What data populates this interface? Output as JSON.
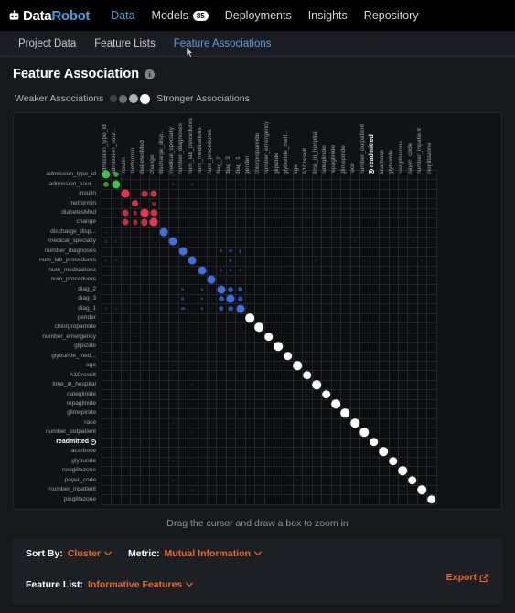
{
  "topnav": {
    "brand_data": "Data",
    "brand_robot": "Robot",
    "brand_icon": "robot-icon",
    "items": [
      {
        "label": "Data",
        "active": true,
        "badge": null
      },
      {
        "label": "Models",
        "active": false,
        "badge": "85"
      },
      {
        "label": "Deployments",
        "active": false,
        "badge": null
      },
      {
        "label": "Insights",
        "active": false,
        "badge": null
      },
      {
        "label": "Repository",
        "active": false,
        "badge": null
      }
    ]
  },
  "tabs": [
    {
      "label": "Project Data",
      "active": false
    },
    {
      "label": "Feature Lists",
      "active": false
    },
    {
      "label": "Feature Associations",
      "active": true
    }
  ],
  "header": {
    "title": "Feature Association",
    "info_icon": "info-icon",
    "info_glyph": "i"
  },
  "legend": {
    "weaker_label": "Weaker Associations",
    "stronger_label": "Stronger Associations",
    "dots": [
      {
        "size": 8,
        "color": "#3e4246"
      },
      {
        "size": 9,
        "color": "#6c7176"
      },
      {
        "size": 10,
        "color": "#aeb3b8"
      },
      {
        "size": 11,
        "color": "#ffffff"
      }
    ]
  },
  "matrix": {
    "zoom_hint": "Drag the cursor and draw a box to zoom in",
    "target_feature": "readmitted",
    "features": [
      "admission_type_id",
      "admission_sour...",
      "insulin",
      "metformin",
      "diabetesMed",
      "change",
      "discharge_disp...",
      "medical_specialty",
      "number_diagnoses",
      "num_lab_procedures",
      "num_medications",
      "num_procedures",
      "diag_2",
      "diag_3",
      "diag_1",
      "gender",
      "chlorpropamide",
      "number_emergency",
      "glipizide",
      "glyburide_metf...",
      "age",
      "A1Cresult",
      "time_in_hospital",
      "nateglinide",
      "repaglinide",
      "glimepiride",
      "race",
      "number_outpatient",
      "readmitted",
      "acarbose",
      "glyburide",
      "rosiglitazone",
      "payer_code",
      "number_inpatient",
      "pioglitazone"
    ],
    "cluster_colors": {
      "green": "#3dc252",
      "red": "#e8344e",
      "blue": "#3f6fe0",
      "white": "#ffffff",
      "faint": "#6d747c"
    }
  },
  "chart_data": {
    "type": "heatmap",
    "title": "Feature Association",
    "xlabel": "",
    "ylabel": "",
    "metric": "Mutual Information",
    "sort_by": "Cluster",
    "clusters": [
      {
        "name": "cluster-green",
        "color": "#3dc252",
        "members": [
          0,
          1
        ]
      },
      {
        "name": "cluster-red",
        "color": "#e8344e",
        "members": [
          2,
          3,
          4,
          5
        ]
      },
      {
        "name": "cluster-blue",
        "color": "#3f6fe0",
        "members": [
          6,
          7,
          8,
          9,
          10,
          11,
          12,
          13,
          14
        ]
      },
      {
        "name": "singletons",
        "color": "#ffffff",
        "members": [
          15,
          16,
          17,
          18,
          19,
          20,
          21,
          22,
          23,
          24,
          25,
          26,
          27,
          28,
          29,
          30,
          31,
          32,
          33,
          34
        ]
      }
    ],
    "cells": [
      {
        "r": 0,
        "c": 0,
        "v": 0.95,
        "g": "green"
      },
      {
        "r": 0,
        "c": 1,
        "v": 0.55,
        "g": "green"
      },
      {
        "r": 1,
        "c": 0,
        "v": 0.55,
        "g": "green"
      },
      {
        "r": 1,
        "c": 1,
        "v": 0.95,
        "g": "green"
      },
      {
        "r": 0,
        "c": 7,
        "v": 0.22,
        "g": "faint"
      },
      {
        "r": 0,
        "c": 9,
        "v": 0.14,
        "g": "faint"
      },
      {
        "r": 1,
        "c": 7,
        "v": 0.2,
        "g": "faint"
      },
      {
        "r": 1,
        "c": 9,
        "v": 0.18,
        "g": "faint"
      },
      {
        "r": 1,
        "c": 12,
        "v": 0.1,
        "g": "faint"
      },
      {
        "r": 1,
        "c": 14,
        "v": 0.14,
        "g": "faint"
      },
      {
        "r": 0,
        "c": 14,
        "v": 0.16,
        "g": "faint"
      },
      {
        "r": 2,
        "c": 2,
        "v": 0.92,
        "g": "red"
      },
      {
        "r": 2,
        "c": 4,
        "v": 0.62,
        "g": "red"
      },
      {
        "r": 2,
        "c": 5,
        "v": 0.66,
        "g": "red"
      },
      {
        "r": 3,
        "c": 3,
        "v": 0.78,
        "g": "red"
      },
      {
        "r": 3,
        "c": 5,
        "v": 0.28,
        "g": "red"
      },
      {
        "r": 4,
        "c": 2,
        "v": 0.62,
        "g": "red"
      },
      {
        "r": 4,
        "c": 3,
        "v": 0.36,
        "g": "red"
      },
      {
        "r": 4,
        "c": 4,
        "v": 0.88,
        "g": "red"
      },
      {
        "r": 4,
        "c": 5,
        "v": 0.7,
        "g": "red"
      },
      {
        "r": 5,
        "c": 2,
        "v": 0.66,
        "g": "red"
      },
      {
        "r": 5,
        "c": 3,
        "v": 0.42,
        "g": "red"
      },
      {
        "r": 5,
        "c": 4,
        "v": 0.7,
        "g": "red"
      },
      {
        "r": 5,
        "c": 5,
        "v": 0.92,
        "g": "red"
      },
      {
        "r": 6,
        "c": 6,
        "v": 0.9,
        "g": "blue"
      },
      {
        "r": 7,
        "c": 7,
        "v": 0.9,
        "g": "blue"
      },
      {
        "r": 8,
        "c": 8,
        "v": 0.9,
        "g": "blue"
      },
      {
        "r": 8,
        "c": 12,
        "v": 0.22,
        "g": "blue"
      },
      {
        "r": 8,
        "c": 13,
        "v": 0.22,
        "g": "blue"
      },
      {
        "r": 8,
        "c": 14,
        "v": 0.24,
        "g": "blue"
      },
      {
        "r": 9,
        "c": 9,
        "v": 0.9,
        "g": "blue"
      },
      {
        "r": 9,
        "c": 13,
        "v": 0.18,
        "g": "blue"
      },
      {
        "r": 10,
        "c": 10,
        "v": 0.9,
        "g": "blue"
      },
      {
        "r": 10,
        "c": 12,
        "v": 0.18,
        "g": "blue"
      },
      {
        "r": 10,
        "c": 13,
        "v": 0.18,
        "g": "blue"
      },
      {
        "r": 10,
        "c": 14,
        "v": 0.2,
        "g": "blue"
      },
      {
        "r": 11,
        "c": 11,
        "v": 0.9,
        "g": "blue"
      },
      {
        "r": 12,
        "c": 8,
        "v": 0.22,
        "g": "blue"
      },
      {
        "r": 12,
        "c": 10,
        "v": 0.18,
        "g": "blue"
      },
      {
        "r": 12,
        "c": 12,
        "v": 0.92,
        "g": "blue"
      },
      {
        "r": 12,
        "c": 13,
        "v": 0.52,
        "g": "blue"
      },
      {
        "r": 12,
        "c": 14,
        "v": 0.48,
        "g": "blue"
      },
      {
        "r": 13,
        "c": 8,
        "v": 0.22,
        "g": "blue"
      },
      {
        "r": 13,
        "c": 10,
        "v": 0.18,
        "g": "blue"
      },
      {
        "r": 13,
        "c": 12,
        "v": 0.52,
        "g": "blue"
      },
      {
        "r": 13,
        "c": 13,
        "v": 0.92,
        "g": "blue"
      },
      {
        "r": 13,
        "c": 14,
        "v": 0.46,
        "g": "blue"
      },
      {
        "r": 14,
        "c": 8,
        "v": 0.24,
        "g": "blue"
      },
      {
        "r": 14,
        "c": 10,
        "v": 0.2,
        "g": "blue"
      },
      {
        "r": 14,
        "c": 12,
        "v": 0.48,
        "g": "blue"
      },
      {
        "r": 14,
        "c": 13,
        "v": 0.46,
        "g": "blue"
      },
      {
        "r": 14,
        "c": 14,
        "v": 0.92,
        "g": "blue"
      },
      {
        "r": 6,
        "c": 0,
        "v": 0.1,
        "g": "faint"
      },
      {
        "r": 7,
        "c": 0,
        "v": 0.2,
        "g": "faint"
      },
      {
        "r": 7,
        "c": 1,
        "v": 0.2,
        "g": "faint"
      },
      {
        "r": 9,
        "c": 0,
        "v": 0.16,
        "g": "faint"
      },
      {
        "r": 9,
        "c": 1,
        "v": 0.16,
        "g": "faint"
      },
      {
        "r": 12,
        "c": 1,
        "v": 0.1,
        "g": "faint"
      },
      {
        "r": 14,
        "c": 0,
        "v": 0.16,
        "g": "faint"
      },
      {
        "r": 14,
        "c": 1,
        "v": 0.16,
        "g": "faint"
      },
      {
        "r": 15,
        "c": 15,
        "v": 1.0,
        "g": "white"
      },
      {
        "r": 16,
        "c": 16,
        "v": 1.0,
        "g": "white"
      },
      {
        "r": 17,
        "c": 17,
        "v": 1.0,
        "g": "white"
      },
      {
        "r": 18,
        "c": 18,
        "v": 1.0,
        "g": "white"
      },
      {
        "r": 19,
        "c": 19,
        "v": 1.0,
        "g": "white"
      },
      {
        "r": 20,
        "c": 20,
        "v": 1.0,
        "g": "white"
      },
      {
        "r": 21,
        "c": 21,
        "v": 1.0,
        "g": "white"
      },
      {
        "r": 22,
        "c": 22,
        "v": 1.0,
        "g": "white"
      },
      {
        "r": 23,
        "c": 23,
        "v": 1.0,
        "g": "white"
      },
      {
        "r": 24,
        "c": 24,
        "v": 1.0,
        "g": "white"
      },
      {
        "r": 25,
        "c": 25,
        "v": 1.0,
        "g": "white"
      },
      {
        "r": 26,
        "c": 26,
        "v": 1.0,
        "g": "white"
      },
      {
        "r": 27,
        "c": 27,
        "v": 1.0,
        "g": "white"
      },
      {
        "r": 28,
        "c": 28,
        "v": 1.0,
        "g": "white"
      },
      {
        "r": 29,
        "c": 29,
        "v": 1.0,
        "g": "white"
      },
      {
        "r": 30,
        "c": 30,
        "v": 1.0,
        "g": "white"
      },
      {
        "r": 31,
        "c": 31,
        "v": 1.0,
        "g": "white"
      },
      {
        "r": 32,
        "c": 32,
        "v": 1.0,
        "g": "white"
      },
      {
        "r": 33,
        "c": 33,
        "v": 1.0,
        "g": "white"
      },
      {
        "r": 34,
        "c": 34,
        "v": 1.0,
        "g": "white"
      },
      {
        "r": 17,
        "c": 3,
        "v": 0.08,
        "g": "faint"
      },
      {
        "r": 20,
        "c": 7,
        "v": 0.1,
        "g": "faint"
      },
      {
        "r": 21,
        "c": 7,
        "v": 0.1,
        "g": "faint"
      },
      {
        "r": 22,
        "c": 9,
        "v": 0.12,
        "g": "faint"
      },
      {
        "r": 26,
        "c": 7,
        "v": 0.1,
        "g": "faint"
      },
      {
        "r": 27,
        "c": 9,
        "v": 0.08,
        "g": "faint"
      },
      {
        "r": 30,
        "c": 7,
        "v": 0.08,
        "g": "faint"
      },
      {
        "r": 32,
        "c": 7,
        "v": 0.12,
        "g": "faint"
      },
      {
        "r": 32,
        "c": 20,
        "v": 0.1,
        "g": "faint"
      },
      {
        "r": 33,
        "c": 9,
        "v": 0.1,
        "g": "faint"
      },
      {
        "r": 3,
        "c": 17,
        "v": 0.08,
        "g": "faint"
      },
      {
        "r": 7,
        "c": 20,
        "v": 0.1,
        "g": "faint"
      },
      {
        "r": 7,
        "c": 21,
        "v": 0.1,
        "g": "faint"
      },
      {
        "r": 9,
        "c": 22,
        "v": 0.12,
        "g": "faint"
      },
      {
        "r": 7,
        "c": 26,
        "v": 0.1,
        "g": "faint"
      },
      {
        "r": 9,
        "c": 27,
        "v": 0.08,
        "g": "faint"
      },
      {
        "r": 7,
        "c": 30,
        "v": 0.08,
        "g": "faint"
      },
      {
        "r": 7,
        "c": 32,
        "v": 0.12,
        "g": "faint"
      },
      {
        "r": 20,
        "c": 32,
        "v": 0.1,
        "g": "faint"
      },
      {
        "r": 9,
        "c": 33,
        "v": 0.1,
        "g": "faint"
      }
    ]
  },
  "controls": {
    "sort_by_label": "Sort By:",
    "sort_by_value": "Cluster",
    "metric_label": "Metric:",
    "metric_value": "Mutual Information",
    "feature_list_label": "Feature List:",
    "feature_list_value": "Informative Features",
    "export_label": "Export",
    "export_icon": "export-icon",
    "chevron": "⌄"
  },
  "accent_color": "#e8692b"
}
